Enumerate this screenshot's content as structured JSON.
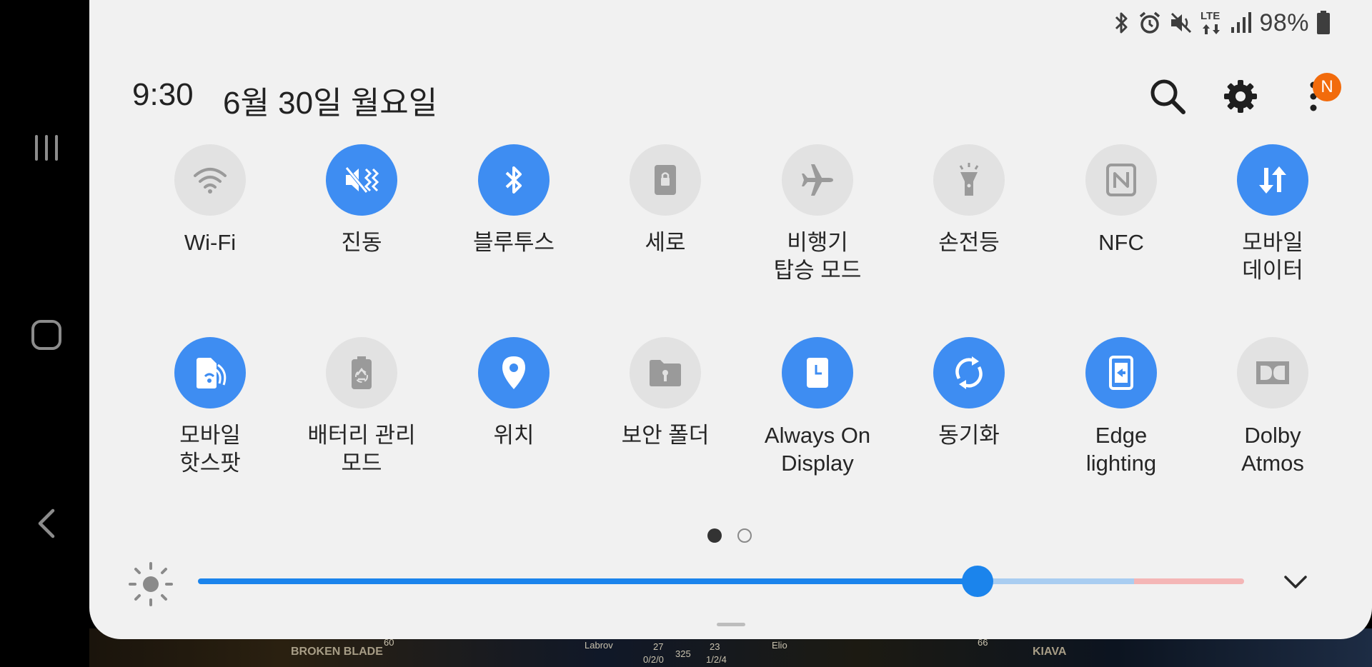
{
  "status": {
    "battery_percent_text": "98%",
    "network_type": "LTE",
    "icons": [
      "bluetooth-icon",
      "alarm-icon",
      "mute-icon",
      "lte-icon",
      "signal-icon",
      "battery-icon"
    ]
  },
  "header": {
    "time": "9:30",
    "date": "6월 30일 월요일",
    "notification_badge": "N"
  },
  "tiles_row1": [
    {
      "label": "Wi-Fi",
      "state": "off",
      "icon": "wifi-icon"
    },
    {
      "label": "진동",
      "state": "on",
      "icon": "vibrate-icon"
    },
    {
      "label": "블루투스",
      "state": "on",
      "icon": "bluetooth-icon"
    },
    {
      "label": "세로",
      "state": "off",
      "icon": "portrait-lock-icon"
    },
    {
      "label": "비행기\n탑승 모드",
      "state": "off",
      "icon": "airplane-icon"
    },
    {
      "label": "손전등",
      "state": "off",
      "icon": "flashlight-icon"
    },
    {
      "label": "NFC",
      "state": "off",
      "icon": "nfc-icon"
    },
    {
      "label": "모바일\n데이터",
      "state": "on",
      "icon": "mobile-data-icon"
    }
  ],
  "tiles_row2": [
    {
      "label": "모바일\n핫스팟",
      "state": "on",
      "icon": "hotspot-icon"
    },
    {
      "label": "배터리 관리\n모드",
      "state": "off",
      "icon": "battery-saver-icon"
    },
    {
      "label": "위치",
      "state": "on",
      "icon": "location-icon"
    },
    {
      "label": "보안 폴더",
      "state": "off",
      "icon": "secure-folder-icon"
    },
    {
      "label": "Always On\nDisplay",
      "state": "on",
      "icon": "always-on-display-icon"
    },
    {
      "label": "동기화",
      "state": "on",
      "icon": "sync-icon"
    },
    {
      "label": "Edge\nlighting",
      "state": "on",
      "icon": "edge-lighting-icon"
    },
    {
      "label": "Dolby\nAtmos",
      "state": "off",
      "icon": "dolby-icon"
    }
  ],
  "pagination": {
    "current": 1,
    "total": 2
  },
  "brightness": {
    "level": 0.745
  },
  "colors": {
    "accent": "#3e8df2",
    "slider": "#1b84ec",
    "panel_bg": "#f1f1f1",
    "tile_off": "#e2e2e2",
    "badge": "#f26b0c"
  },
  "background_game": {
    "labels": [
      "BROKEN BLADE",
      "Labrov",
      "Elio",
      "KIAVA"
    ],
    "numbers": [
      "60",
      "27",
      "0/2/0",
      "325",
      "23",
      "1/2/4",
      "66"
    ]
  }
}
